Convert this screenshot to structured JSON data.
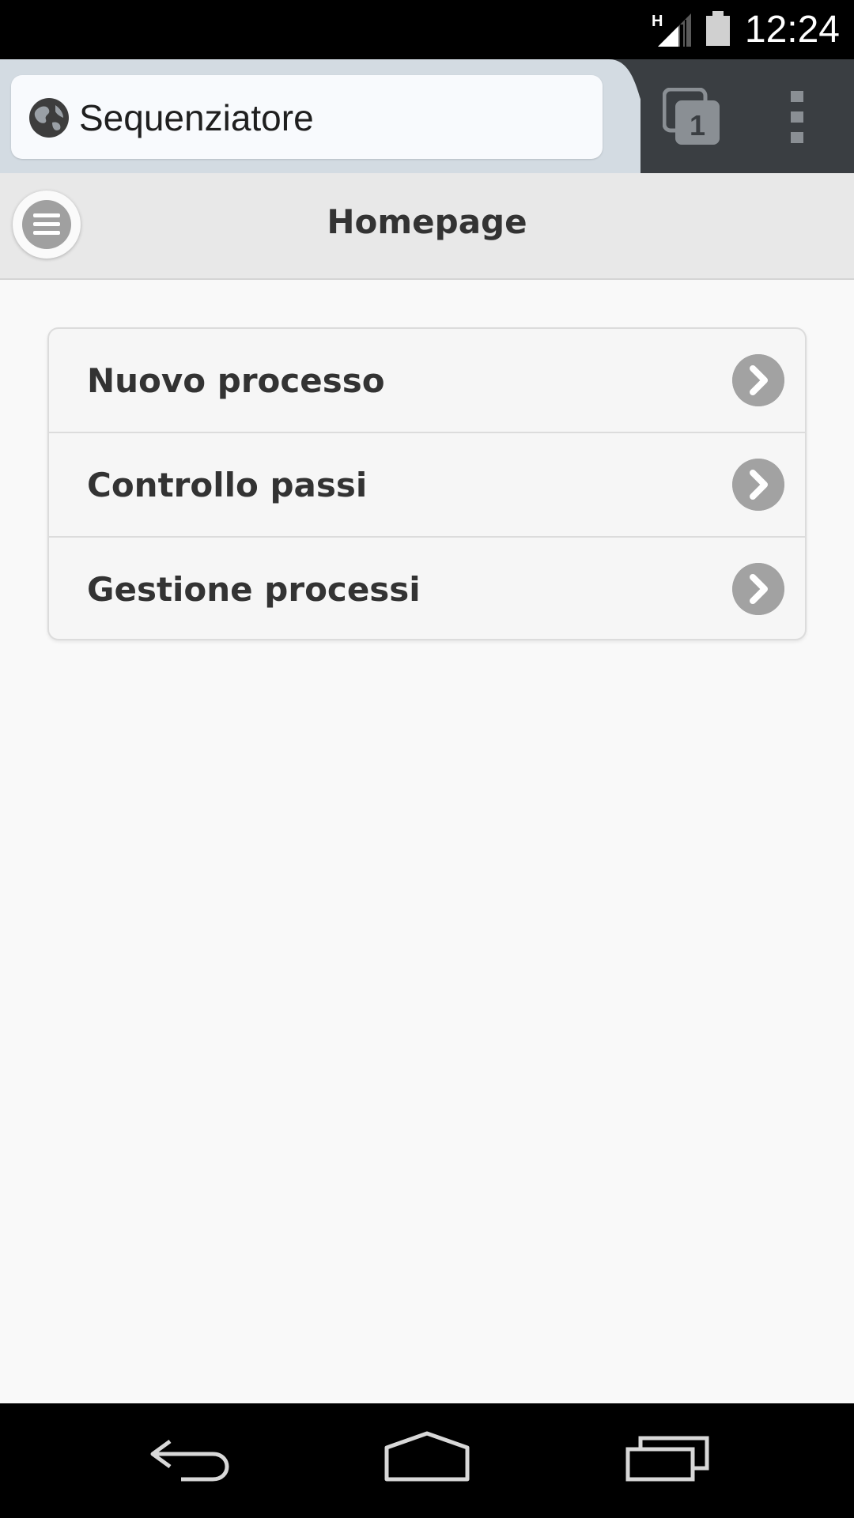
{
  "status_bar": {
    "time": "12:24",
    "network_label": "H",
    "icons": [
      "signal-icon",
      "battery-icon"
    ]
  },
  "browser": {
    "url_text": "Sequenziatore",
    "tab_count": "1",
    "icons": [
      "globe-icon",
      "tabs-icon",
      "overflow-menu-icon"
    ]
  },
  "header": {
    "title": "Homepage",
    "menu_icon": "hamburger-icon"
  },
  "menu": {
    "items": [
      {
        "label": "Nuovo processo",
        "icon": "chevron-right-icon"
      },
      {
        "label": "Controllo passi",
        "icon": "chevron-right-icon"
      },
      {
        "label": "Gestione processi",
        "icon": "chevron-right-icon"
      }
    ]
  },
  "nav_bar": {
    "icons": [
      "back-icon",
      "home-icon",
      "recent-apps-icon"
    ]
  },
  "colors": {
    "status_bar": "#000000",
    "browser_toolbar": "#3a3e42",
    "url_field": "#f8fafd",
    "header_bg": "#e8e8e8",
    "page_bg": "#f9f9f9",
    "list_bg": "#f6f6f6",
    "icon_gray": "#a2a2a2",
    "text": "#333333"
  }
}
